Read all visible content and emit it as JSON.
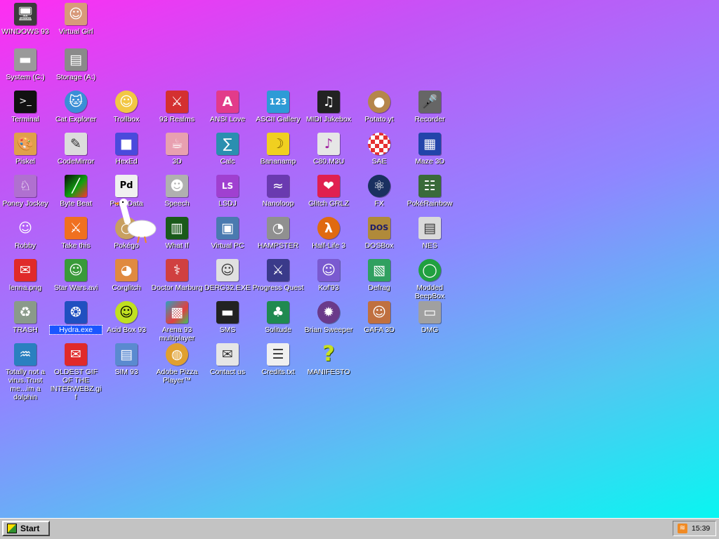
{
  "desktop": {
    "icons": [
      {
        "id": "windows93",
        "label": "WINDOWS 93",
        "glyph": "🖥",
        "color": "#3c3c3c"
      },
      {
        "id": "virtual-girl",
        "label": "Virtual Girl",
        "glyph": "☺",
        "color": "#d89a7a"
      },
      {
        "id": "system-c",
        "label": "System (C:)",
        "glyph": "▬",
        "color": "#9a9a9a"
      },
      {
        "id": "storage-a",
        "label": "Storage (A:)",
        "glyph": "▤",
        "color": "#8a8a8a"
      },
      {
        "id": "terminal",
        "label": "Terminal",
        "glyph": ">_",
        "color": "#111111"
      },
      {
        "id": "cat-explorer",
        "label": "Cat Explorer",
        "glyph": "🐱",
        "color": "#3a8fd6"
      },
      {
        "id": "trollbox",
        "label": "Trollbox",
        "glyph": "☺",
        "color": "#f2c744"
      },
      {
        "id": "93-realms",
        "label": "93 Realms",
        "glyph": "⚔",
        "color": "#d43030"
      },
      {
        "id": "ansi-love",
        "label": "ANSI Love",
        "glyph": "A",
        "color": "#e23b8a"
      },
      {
        "id": "ascii-gallery",
        "label": "ASCII Gallery",
        "glyph": "123",
        "color": "#2e9bd6"
      },
      {
        "id": "midi-jukebox",
        "label": "MIDI Jukebox",
        "glyph": "♫",
        "color": "#222222"
      },
      {
        "id": "potato-yt",
        "label": "Potato.yt",
        "glyph": "●",
        "color": "#b5864a"
      },
      {
        "id": "recorder",
        "label": "Recorder",
        "glyph": "🎤",
        "color": "#666666"
      },
      {
        "id": "piskel",
        "label": "Piskel",
        "glyph": "🎨",
        "color": "#e0a04a"
      },
      {
        "id": "codemirror",
        "label": "CodeMirror",
        "glyph": "✎",
        "color": "#dcdcdc"
      },
      {
        "id": "hexed",
        "label": "HexEd",
        "glyph": "■",
        "color": "#4a4adc"
      },
      {
        "id": "3d",
        "label": "3D",
        "glyph": "☕",
        "color": "#e8a0b0"
      },
      {
        "id": "calc",
        "label": "Calc",
        "glyph": "∑",
        "color": "#2a8fb0"
      },
      {
        "id": "bananamp",
        "label": "Bananamp",
        "glyph": "☽",
        "color": "#f0d020"
      },
      {
        "id": "c80-m3u",
        "label": "C80.M3U",
        "glyph": "♪",
        "color": "#e6e6e6"
      },
      {
        "id": "sae",
        "label": "SAE",
        "glyph": "◉",
        "color": "#e63030"
      },
      {
        "id": "maze-3d",
        "label": "Maze 3D",
        "glyph": "▦",
        "color": "#2244aa"
      },
      {
        "id": "poney-jockey",
        "label": "Poney Jockey",
        "glyph": "♘",
        "color": "#b070d0"
      },
      {
        "id": "byte-beat",
        "label": "Byte Beat",
        "glyph": "╱",
        "color": "#107010"
      },
      {
        "id": "pure-data",
        "label": "Pure Data",
        "glyph": "Pd",
        "color": "#f0f0f0"
      },
      {
        "id": "speech",
        "label": "Speech",
        "glyph": "☻",
        "color": "#b0b0b0"
      },
      {
        "id": "lsdj",
        "label": "LSDJ",
        "glyph": "LS",
        "color": "#a040d0"
      },
      {
        "id": "nanoloop",
        "label": "Nanoloop",
        "glyph": "≈",
        "color": "#6a3ab0"
      },
      {
        "id": "glitch-grlz",
        "label": "Glitch GRLZ",
        "glyph": "❤",
        "color": "#e02050"
      },
      {
        "id": "fx",
        "label": "FX",
        "glyph": "⚛",
        "color": "#1a3060"
      },
      {
        "id": "pokerainbow",
        "label": "PokéRainbow",
        "glyph": "☷",
        "color": "#3a6a3a"
      },
      {
        "id": "robby",
        "label": "Robby",
        "glyph": "☺",
        "color": "#c040c0"
      },
      {
        "id": "take-this",
        "label": "Take this",
        "glyph": "⚔",
        "color": "#f07020"
      },
      {
        "id": "pokegoose",
        "label": "Pokégo",
        "glyph": "○",
        "color": "#c8a060"
      },
      {
        "id": "what-if",
        "label": "What If",
        "glyph": "▥",
        "color": "#1a5a1a"
      },
      {
        "id": "virtual-pc",
        "label": "Virtual PC",
        "glyph": "▣",
        "color": "#4a7ab0"
      },
      {
        "id": "hampster",
        "label": "HAMPSTER",
        "glyph": "◔",
        "color": "#909090"
      },
      {
        "id": "half-life-3",
        "label": "Half-Life 3",
        "glyph": "λ",
        "color": "#e06a10"
      },
      {
        "id": "dosbox",
        "label": "DOSBox",
        "glyph": "DOS",
        "color": "#b08a3a"
      },
      {
        "id": "nes",
        "label": "NES",
        "glyph": "▤",
        "color": "#dadada"
      },
      {
        "id": "lenna-png",
        "label": "lenna.png",
        "glyph": "✉",
        "color": "#e02a2a"
      },
      {
        "id": "star-wars-avi",
        "label": "Star Wars.avi",
        "glyph": "☺",
        "color": "#3a9a3a"
      },
      {
        "id": "corglitch",
        "label": "Corglitch",
        "glyph": "◕",
        "color": "#e08a40"
      },
      {
        "id": "doctor-marburg",
        "label": "Doctor Marburg",
        "glyph": "⚕",
        "color": "#d04040"
      },
      {
        "id": "derg32-exe",
        "label": "DERG32.EXE",
        "glyph": "☺",
        "color": "#e0e0e0"
      },
      {
        "id": "progress-quest",
        "label": "Progress Quest",
        "glyph": "⚔",
        "color": "#3a3a8a"
      },
      {
        "id": "kof93",
        "label": "Kof'93",
        "glyph": "☺",
        "color": "#7a5ad0"
      },
      {
        "id": "defrag",
        "label": "Defrag",
        "glyph": "▧",
        "color": "#30a060"
      },
      {
        "id": "modded-beepbox",
        "label": "Modded BeepBox",
        "glyph": "◯",
        "color": "#20a040"
      },
      {
        "id": "trash",
        "label": "TRASH",
        "glyph": "♻",
        "color": "#8a9a8a"
      },
      {
        "id": "hydra-exe",
        "label": "Hydra.exe",
        "glyph": "❂",
        "color": "#2050c0"
      },
      {
        "id": "acid-box-93",
        "label": "Acid Box 93",
        "glyph": "☺",
        "color": "#c0e020"
      },
      {
        "id": "arena-93",
        "label": "Arena 93 multiplayer",
        "glyph": "▩",
        "color": "#30a0c0"
      },
      {
        "id": "sms",
        "label": "SMS",
        "glyph": "▬",
        "color": "#222222"
      },
      {
        "id": "solitude",
        "label": "Solitude",
        "glyph": "♣",
        "color": "#208a50"
      },
      {
        "id": "brian-sweeper",
        "label": "Brian Sweeper",
        "glyph": "✹",
        "color": "#6a3a8a"
      },
      {
        "id": "gafa-3d",
        "label": "GAFA 3D",
        "glyph": "☺",
        "color": "#c07040"
      },
      {
        "id": "dmg",
        "label": "DMG",
        "glyph": "▭",
        "color": "#a0a0a0"
      },
      {
        "id": "dolphin",
        "label": "Totally not a virus.Trust me...im a dolphin",
        "glyph": "♒",
        "color": "#2a80c0"
      },
      {
        "id": "oldest-gif",
        "label": "OLDEST GIF OF THE INTERWEBZ.gif",
        "glyph": "✉",
        "color": "#e02a2a"
      },
      {
        "id": "sim-93",
        "label": "SIM 93",
        "glyph": "▤",
        "color": "#5a8ad0"
      },
      {
        "id": "adobe-pizza",
        "label": "Adobe Pizza Player™",
        "glyph": "◍",
        "color": "#e0a030"
      },
      {
        "id": "contact-us",
        "label": "Contact us",
        "glyph": "✉",
        "color": "#e6e6e6"
      },
      {
        "id": "credits-txt",
        "label": "Credits.txt",
        "glyph": "☰",
        "color": "#f0f0f0"
      },
      {
        "id": "manifesto",
        "label": "MANIFESTO",
        "glyph": "?",
        "color": "#c8e020"
      }
    ]
  },
  "taskbar": {
    "start_label": "Start",
    "clock": "15:39",
    "tray_icon": "rss-icon"
  }
}
